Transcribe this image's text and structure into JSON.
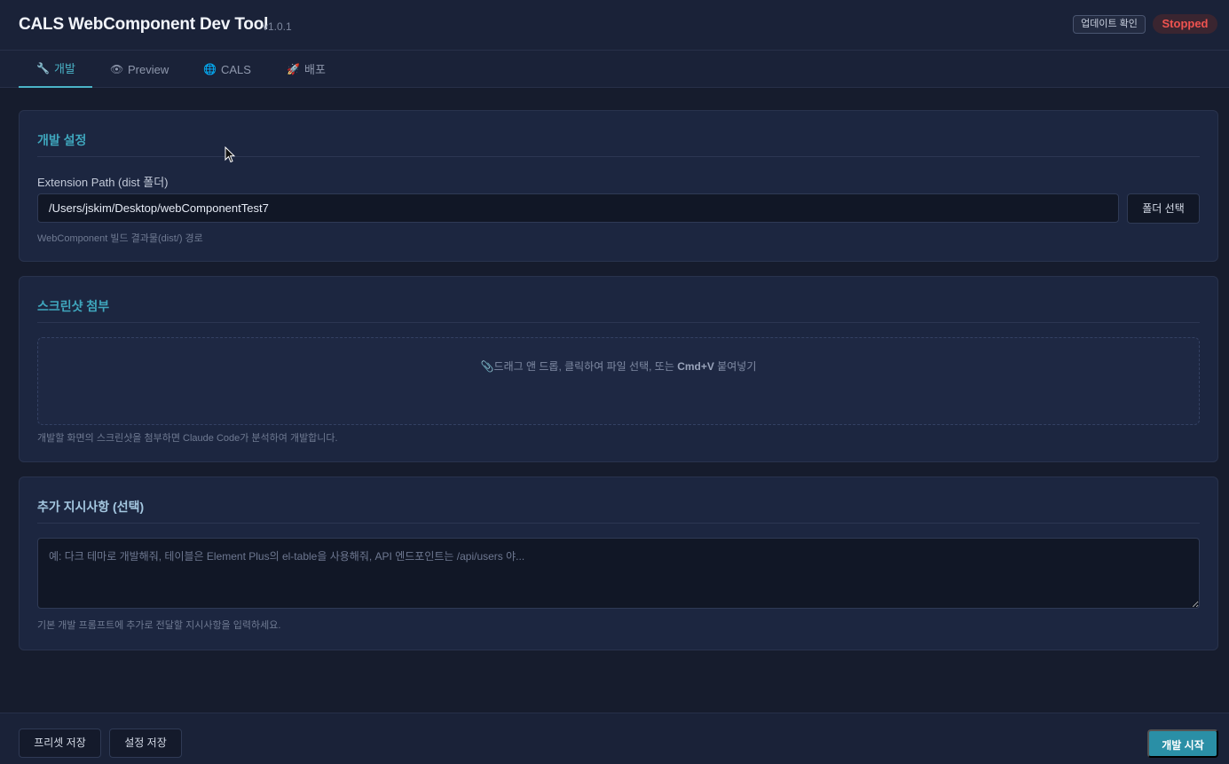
{
  "header": {
    "title": "CALS WebComponent Dev Tool",
    "version": "v1.0.1",
    "update_label": "업데이트 확인",
    "status": "Stopped"
  },
  "tabs": [
    {
      "icon": "wrench-icon",
      "glyph": "🔧",
      "label": "개발",
      "active": true
    },
    {
      "icon": "eye-icon",
      "glyph": "👁",
      "label": "Preview",
      "active": false
    },
    {
      "icon": "globe-icon",
      "glyph": "🌐",
      "label": "CALS",
      "active": false
    },
    {
      "icon": "rocket-icon",
      "glyph": "🚀",
      "label": "배포",
      "active": false
    }
  ],
  "dev_settings": {
    "title": "개발 설정",
    "path_label": "Extension Path (dist 폴더)",
    "path_value": "/Users/jskim/Desktop/webComponentTest7",
    "folder_button": "폴더 선택",
    "hint": "WebComponent 빌드 결과물(dist/) 경로"
  },
  "screenshot": {
    "title": "스크린샷 첨부",
    "drop_before": "드래그 앤 드롭, 클릭하여 파일 선택, 또는 ",
    "drop_shortcut": "Cmd+V",
    "drop_after": " 붙여넣기",
    "hint": "개발할 화면의 스크린샷을 첨부하면 Claude Code가 분석하여 개발합니다."
  },
  "instructions": {
    "title": "추가 지시사항 (선택)",
    "placeholder": "예: 다크 테마로 개발해줘, 테이블은 Element Plus의 el-table을 사용해줘, API 엔드포인트는 /api/users 야...",
    "hint": "기본 개발 프롬프트에 추가로 전달할 지시사항을 입력하세요."
  },
  "footer": {
    "preset_save": "프리셋 저장",
    "settings_save": "설정 저장",
    "start": "개발 시작"
  },
  "colors": {
    "accent": "#3fa6bd",
    "status_stopped": "#ef5350",
    "primary_button": "#2a8fa6"
  }
}
